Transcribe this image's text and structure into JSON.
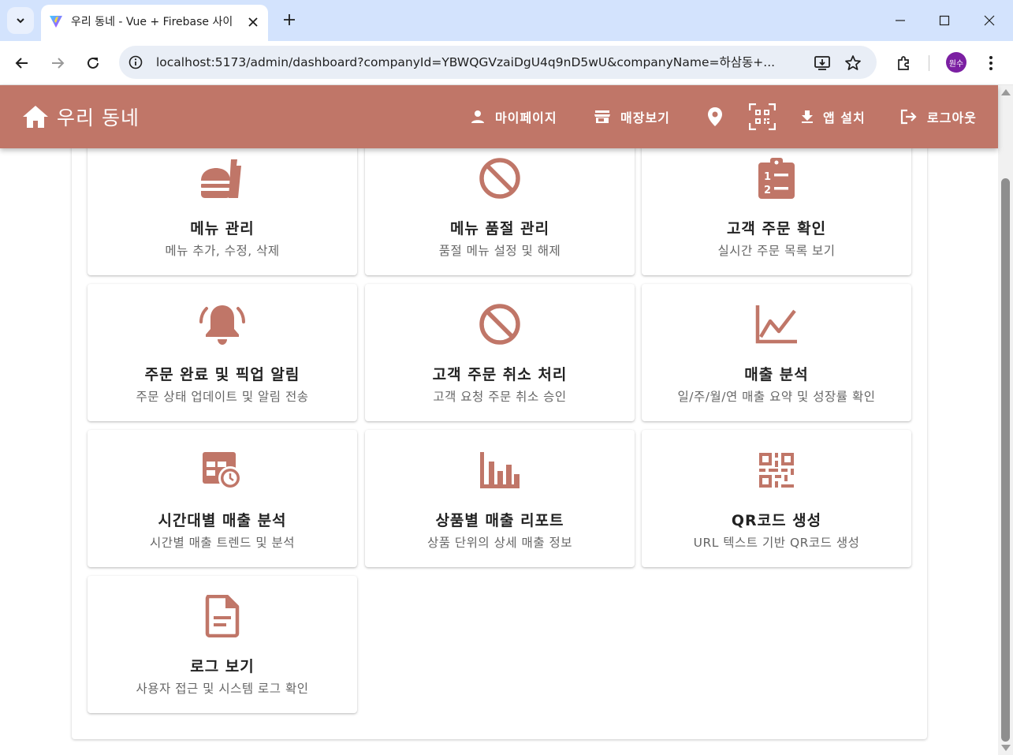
{
  "browser": {
    "tab_title": "우리 동네 - Vue + Firebase 사이",
    "url": "localhost:5173/admin/dashboard?companyId=YBWQGVzaiDgU4q9nD5wU&companyName=하삼동+...",
    "profile_label": "원수"
  },
  "header": {
    "title": "우리 동네",
    "nav": {
      "mypage": "마이페이지",
      "store": "매장보기",
      "install": "앱 설치",
      "logout": "로그아웃"
    }
  },
  "cards": [
    {
      "title": "메뉴 관리",
      "subtitle": "메뉴 추가, 수정, 삭제",
      "icon": "food-icon"
    },
    {
      "title": "메뉴 품절 관리",
      "subtitle": "품절 메뉴 설정 및 해제",
      "icon": "cancel-icon"
    },
    {
      "title": "고객 주문 확인",
      "subtitle": "실시간 주문 목록 보기",
      "icon": "clipboard-list-icon"
    },
    {
      "title": "주문 완료 및 픽업 알림",
      "subtitle": "주문 상태 업데이트 및 알림 전송",
      "icon": "bell-ring-icon"
    },
    {
      "title": "고객 주문 취소 처리",
      "subtitle": "고객 요청 주문 취소 승인",
      "icon": "cancel-icon"
    },
    {
      "title": "매출 분석",
      "subtitle": "일/주/월/연 매출 요약 및 성장률 확인",
      "icon": "chart-line-icon"
    },
    {
      "title": "시간대별 매출 분석",
      "subtitle": "시간별 매출 트렌드 및 분석",
      "icon": "table-clock-icon"
    },
    {
      "title": "상품별 매출 리포트",
      "subtitle": "상품 단위의 상세 매출 정보",
      "icon": "bar-chart-icon"
    },
    {
      "title": "QR코드 생성",
      "subtitle": "URL 텍스트 기반 QR코드 생성",
      "icon": "qrcode-icon"
    },
    {
      "title": "로그 보기",
      "subtitle": "사용자 접근 및 시스템 로그 확인",
      "icon": "file-document-icon"
    }
  ],
  "colors": {
    "accent": "#c07668",
    "browser_frame": "#d3e3fd"
  }
}
